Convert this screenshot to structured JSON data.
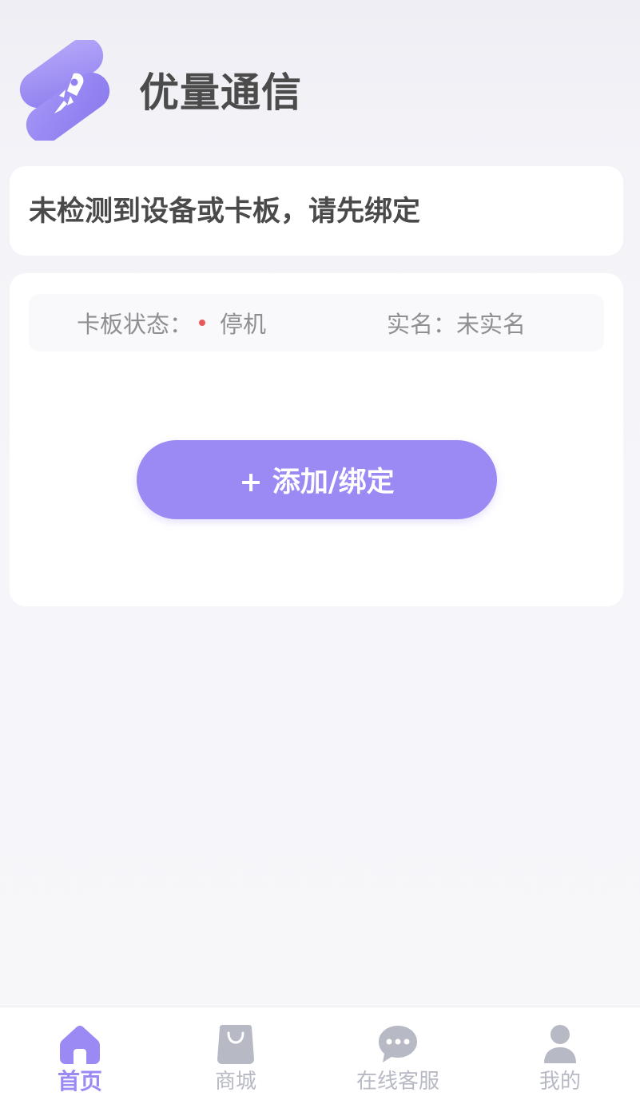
{
  "app": {
    "title": "优量通信",
    "logo_icon": "rocket-logo-icon"
  },
  "notice": {
    "text": "未检测到设备或卡板，请先绑定"
  },
  "status": {
    "card_status_label": "卡板状态：",
    "card_status_value": "停机",
    "card_status_color": "#e85a5a",
    "realname_label": "实名：",
    "realname_value": "未实名"
  },
  "actions": {
    "add_bind_label": "+ 添加/绑定"
  },
  "tabbar": {
    "active_color": "#9b8af4",
    "inactive_color": "#b7b9c4",
    "items": [
      {
        "label": "首页",
        "icon": "home-icon",
        "active": true
      },
      {
        "label": "商城",
        "icon": "shopping-bag-icon",
        "active": false
      },
      {
        "label": "在线客服",
        "icon": "chat-bubble-icon",
        "active": false
      },
      {
        "label": "我的",
        "icon": "user-icon",
        "active": false
      }
    ]
  }
}
